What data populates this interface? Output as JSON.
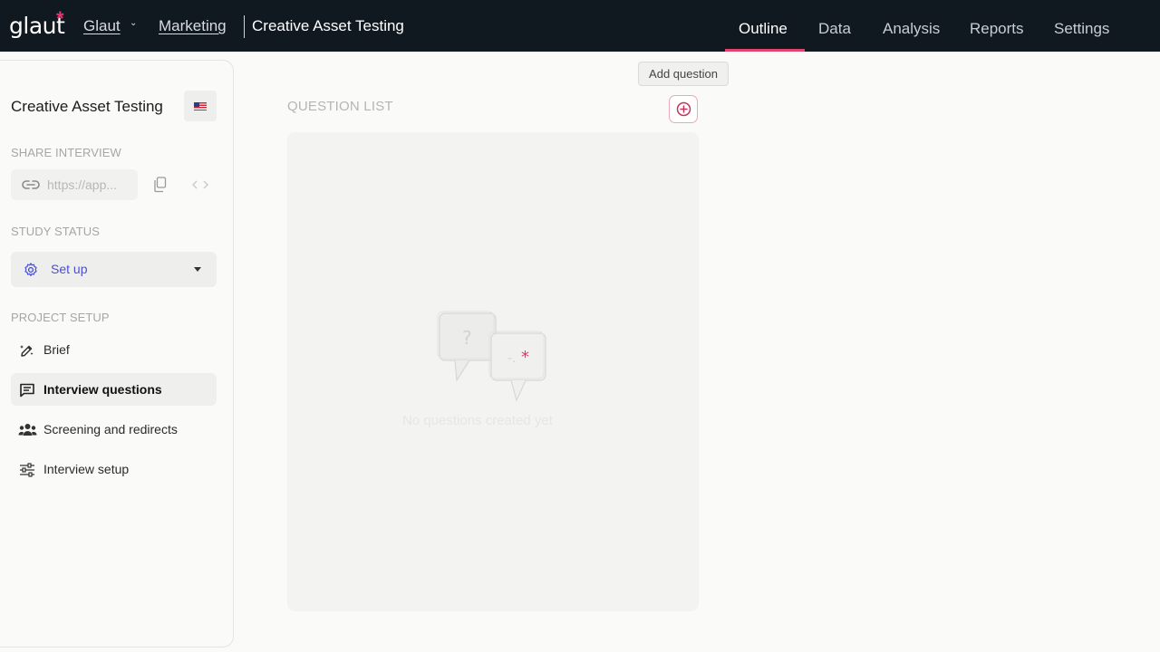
{
  "header": {
    "logo": "glaut",
    "breadcrumb": {
      "org": "Glaut",
      "project": "Marketing",
      "current": "Creative Asset Testing"
    },
    "tabs": [
      {
        "label": "Outline",
        "active": true
      },
      {
        "label": "Data",
        "active": false
      },
      {
        "label": "Analysis",
        "active": false
      },
      {
        "label": "Reports",
        "active": false
      },
      {
        "label": "Settings",
        "active": false
      }
    ],
    "accent_color": "#e0446f"
  },
  "sidebar": {
    "title": "Creative Asset Testing",
    "language_flag": "us-flag-icon",
    "share": {
      "label": "SHARE INTERVIEW",
      "link_value": "https://app..."
    },
    "status": {
      "label": "STUDY STATUS",
      "value": "Set up",
      "color": "#4a4fd4"
    },
    "setup": {
      "label": "PROJECT SETUP",
      "items": [
        {
          "label": "Brief",
          "icon": "pencil-sparkle-icon",
          "active": false
        },
        {
          "label": "Interview questions",
          "icon": "chat-lines-icon",
          "active": true
        },
        {
          "label": "Screening and redirects",
          "icon": "group-icon",
          "active": false
        },
        {
          "label": "Interview setup",
          "icon": "sliders-icon",
          "active": false
        }
      ]
    }
  },
  "main": {
    "question_list_label": "QUESTION LIST",
    "add_tooltip": "Add question",
    "empty_text": "No questions created yet"
  }
}
